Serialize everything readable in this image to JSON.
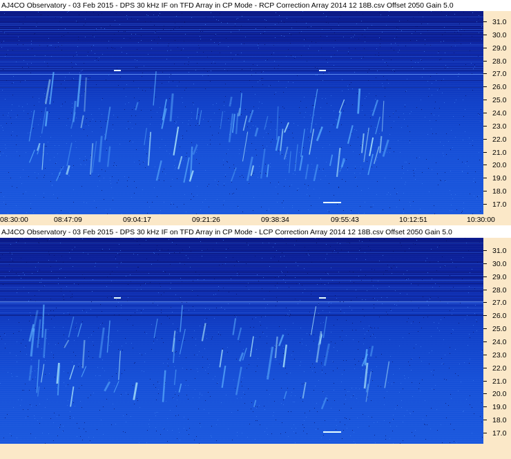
{
  "panels": [
    {
      "title": "AJ4CO Observatory - 03 Feb 2015 - DPS 30 kHz IF on TFD Array in CP Mode - RCP      Correction Array 2014 12 18B.csv      Offset 2050    Gain 5.0",
      "polarization": "RCP"
    },
    {
      "title": "AJ4CO Observatory - 03 Feb 2015 - DPS 30 kHz IF on TFD Array in CP Mode - LCP      Correction Array 2014 12 18B.csv      Offset 2050    Gain 5.0",
      "polarization": "LCP"
    }
  ],
  "y_axis": {
    "labels": [
      "31.0",
      "30.0",
      "29.0",
      "28.0",
      "27.0",
      "26.0",
      "25.0",
      "24.0",
      "23.0",
      "22.0",
      "21.0",
      "20.0",
      "19.0",
      "18.0",
      "17.0"
    ]
  },
  "x_axis": {
    "labels": [
      "08:30:00",
      "08:47:09",
      "09:04:17",
      "09:21:26",
      "09:38:34",
      "09:55:43",
      "10:12:51",
      "10:30:00"
    ]
  },
  "colors": {
    "background_dark": "#0a1a8c",
    "background_light": "#1a58de",
    "axis_bg": "#fbe8c8",
    "burst": "#7fd8ff"
  }
}
